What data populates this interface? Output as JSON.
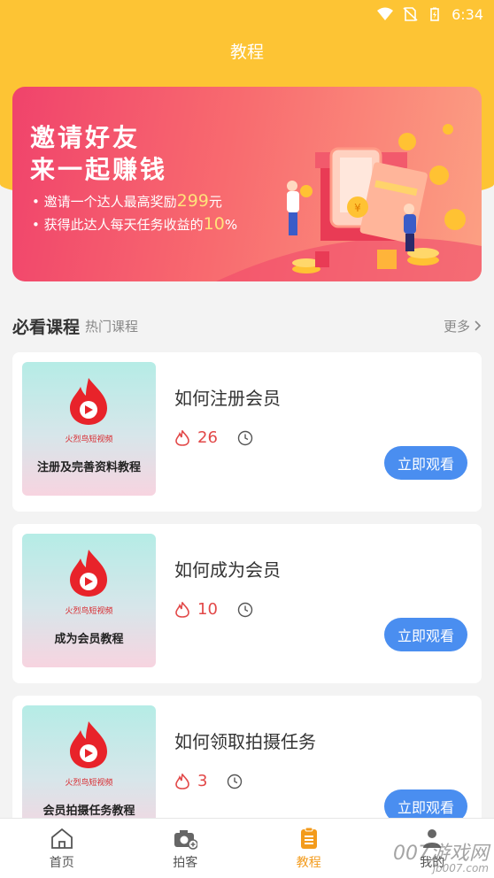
{
  "status_bar": {
    "time": "6:34"
  },
  "header": {
    "title": "教程"
  },
  "banner": {
    "line1": "邀请好友",
    "line2": "来一起赚钱",
    "bullet1_pre": "• 邀请一个达人最高奖励",
    "bullet1_amount": "299",
    "bullet1_post": "元",
    "bullet2_pre": "• 获得此达人每天任务收益的",
    "bullet2_amount": "10",
    "bullet2_post": "%",
    "coin_symbol": "¥"
  },
  "section": {
    "title": "必看课程",
    "subtitle": "热门课程",
    "more": "更多"
  },
  "brand_line": "火烈鸟短视频",
  "courses": [
    {
      "thumb_caption": "注册及完善资料教程",
      "title": "如何注册会员",
      "views": "26",
      "button": "立即观看"
    },
    {
      "thumb_caption": "成为会员教程",
      "title": "如何成为会员",
      "views": "10",
      "button": "立即观看"
    },
    {
      "thumb_caption": "会员拍摄任务教程",
      "title": "如何领取拍摄任务",
      "views": "3",
      "button": "立即观看"
    }
  ],
  "tabbar": [
    {
      "label": "首页",
      "icon": "home-icon"
    },
    {
      "label": "拍客",
      "icon": "camera-icon"
    },
    {
      "label": "教程",
      "icon": "tutorial-icon",
      "active": true
    },
    {
      "label": "我的",
      "icon": "user-icon"
    }
  ],
  "watermark": {
    "main": "007游戏网",
    "sub": "jb007.com"
  },
  "colors": {
    "header": "#fdc434",
    "accent": "#f39b1c",
    "button": "#4a8ef0",
    "count": "#e24848",
    "banner_start": "#f0436b",
    "banner_end": "#fca083"
  }
}
